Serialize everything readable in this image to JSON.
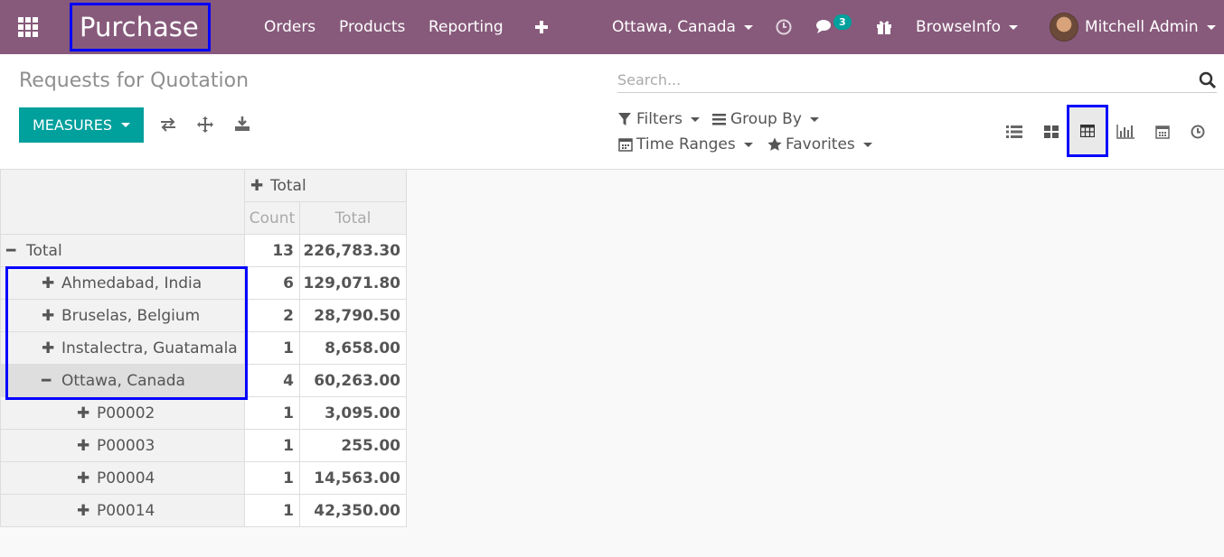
{
  "navbar": {
    "brand": "Purchase",
    "menu": [
      "Orders",
      "Products",
      "Reporting"
    ],
    "add_icon": "plus-icon",
    "company": "Ottawa, Canada",
    "messages_count": "3",
    "user_menu": "BrowseInfo",
    "user_name": "Mitchell Admin"
  },
  "control_panel": {
    "breadcrumb": "Requests for Quotation",
    "measures_label": "MEASURES",
    "search_placeholder": "Search...",
    "filters_label": "Filters",
    "groupby_label": "Group By",
    "timeranges_label": "Time Ranges",
    "favorites_label": "Favorites",
    "views": [
      "list-view-icon",
      "kanban-view-icon",
      "pivot-view-icon",
      "graph-view-icon",
      "calendar-view-icon",
      "activity-view-icon"
    ],
    "active_view": "pivot-view-icon"
  },
  "pivot": {
    "col_header": "Total",
    "measures": [
      "Count",
      "Total"
    ],
    "rows": [
      {
        "label": "Total",
        "count": "13",
        "total": "226,783.30",
        "level": 0,
        "expanded": true
      },
      {
        "label": "Ahmedabad, India",
        "count": "6",
        "total": "129,071.80",
        "level": 1,
        "expanded": false
      },
      {
        "label": "Bruselas, Belgium",
        "count": "2",
        "total": "28,790.50",
        "level": 1,
        "expanded": false
      },
      {
        "label": "Instalectra, Guatamala",
        "count": "1",
        "total": "8,658.00",
        "level": 1,
        "expanded": false
      },
      {
        "label": "Ottawa, Canada",
        "count": "4",
        "total": "60,263.00",
        "level": 1,
        "expanded": true
      },
      {
        "label": "P00002",
        "count": "1",
        "total": "3,095.00",
        "level": 2,
        "expanded": false
      },
      {
        "label": "P00003",
        "count": "1",
        "total": "255.00",
        "level": 2,
        "expanded": false
      },
      {
        "label": "P00004",
        "count": "1",
        "total": "14,563.00",
        "level": 2,
        "expanded": false
      },
      {
        "label": "P00014",
        "count": "1",
        "total": "42,350.00",
        "level": 2,
        "expanded": false
      }
    ]
  },
  "colors": {
    "navbar": "#875a7b",
    "primary": "#00a09d",
    "highlight": "#0000ff"
  }
}
